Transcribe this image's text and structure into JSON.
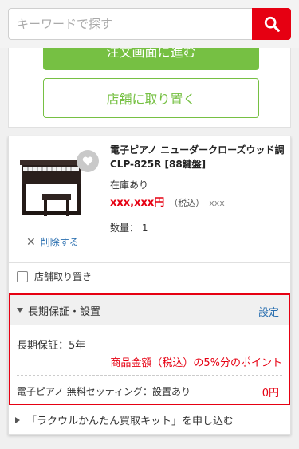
{
  "search": {
    "placeholder": "キーワードで探す",
    "button_icon": "search-icon"
  },
  "actions": {
    "order_label": "注文画面に進む",
    "store_pickup_label": "店舗に取り置く"
  },
  "item": {
    "title": "電子ピアノ ニューダークローズウッド調 CLP-825R [88鍵盤]",
    "stock": "在庫あり",
    "price": "xxx,xxx円",
    "tax_label": "（税込）",
    "price_extra": "xxx",
    "quantity": "数量： 1",
    "delete_label": "削除する",
    "pickup_label": "店舗取り置き"
  },
  "warranty": {
    "header": "長期保証・設置",
    "set_link": "設定",
    "warranty_label": "長期保証：5年",
    "points_text": "商品金額（税込）の5%分のポイント",
    "setting_label": "電子ピアノ 無料セッティング：設置あり",
    "setting_price": "0円"
  },
  "trade_in": {
    "label": "「ラクウルかんたん買取キット」を申し込む"
  },
  "colors": {
    "accent_red": "#e60012",
    "green": "#76c043",
    "link_blue": "#2a6fb0"
  }
}
